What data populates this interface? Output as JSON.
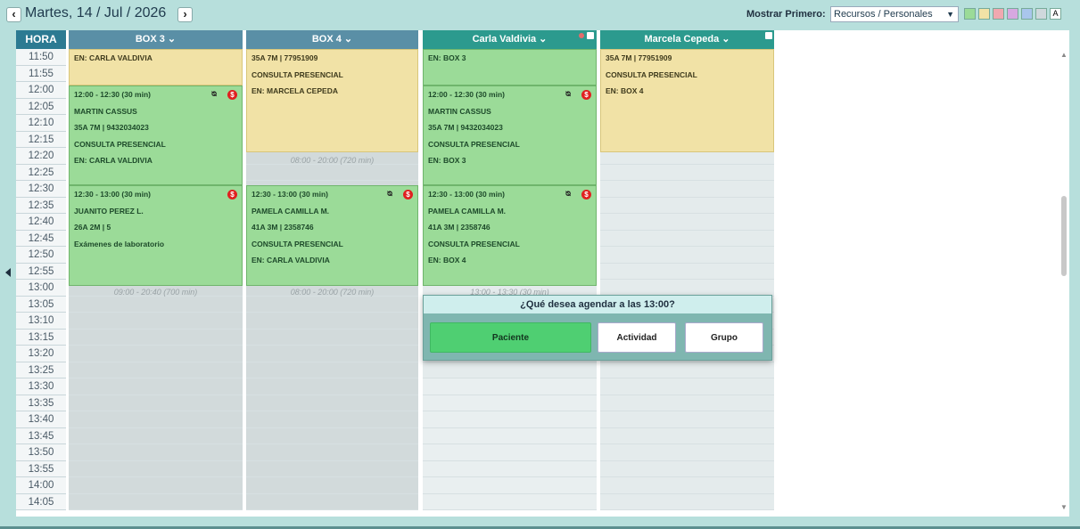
{
  "header": {
    "date_title": "Martes, 14 / Jul / 2026",
    "prev_icon": "chevron-left-icon",
    "next_icon": "chevron-right-icon",
    "show_first_label": "Mostrar Primero:",
    "show_first_value": "Recursos / Personales",
    "color_filters": [
      "#9bdb98",
      "#f1e2a6",
      "#f0a8b0",
      "#d7a8e0",
      "#a9c6ec",
      "#cfd8dc"
    ],
    "color_filter_text": "A"
  },
  "grid": {
    "hora_label": "HORA",
    "times": [
      "11:50",
      "11:55",
      "12:00",
      "12:05",
      "12:10",
      "12:15",
      "12:20",
      "12:25",
      "12:30",
      "12:35",
      "12:40",
      "12:45",
      "12:50",
      "12:55",
      "13:00",
      "13:05",
      "13:10",
      "13:15",
      "13:20",
      "13:25",
      "13:30",
      "13:35",
      "13:40",
      "13:45",
      "13:50",
      "13:55",
      "14:00",
      "14:05"
    ],
    "columns": [
      {
        "title": "BOX 3 ⌄",
        "color": "#5a8fa6"
      },
      {
        "title": "BOX 4 ⌄",
        "color": "#5a8fa6"
      },
      {
        "title": "Carla Valdivia ⌄",
        "color": "#2c9a8e"
      },
      {
        "title": "Marcela Cepeda ⌄",
        "color": "#2c9a8e"
      }
    ]
  },
  "appointments": {
    "box3_top": [
      "EN: CARLA VALDIVIA"
    ],
    "box3_a": [
      "12:00 - 12:30 (30 min)",
      "MARTIN CASSUS",
      "35A 7M | 9432034023",
      "CONSULTA PRESENCIAL",
      "EN: CARLA VALDIVIA"
    ],
    "box3_b": [
      "12:30 - 13:00 (30 min)",
      "JUANITO PEREZ L.",
      "26A 2M | 5",
      "Exámenes de laboratorio"
    ],
    "box3_avail": "09:00 - 20:40 (700 min)",
    "box4_top": [
      "35A 7M | 77951909",
      "CONSULTA PRESENCIAL",
      "EN: MARCELA CEPEDA"
    ],
    "box4_avail1": "08:00 - 20:00 (720 min)",
    "box4_b": [
      "12:30 - 13:00 (30 min)",
      "PAMELA CAMILLA M.",
      "41A 3M | 2358746",
      "CONSULTA PRESENCIAL",
      "EN: CARLA VALDIVIA"
    ],
    "box4_avail2": "08:00 - 20:00 (720 min)",
    "carla_top": [
      "EN: BOX 3"
    ],
    "carla_a": [
      "12:00 - 12:30 (30 min)",
      "MARTIN CASSUS",
      "35A 7M | 9432034023",
      "CONSULTA PRESENCIAL",
      "EN: BOX 3"
    ],
    "carla_b": [
      "12:30 - 13:00 (30 min)",
      "PAMELA CAMILLA M.",
      "41A 3M | 2358746",
      "CONSULTA PRESENCIAL",
      "EN: BOX 4"
    ],
    "carla_avail": "13:00 - 13:30 (30 min)",
    "marcela_top": [
      "35A 7M | 77951909",
      "CONSULTA PRESENCIAL",
      "EN: BOX 4"
    ],
    "payment_badge": "$"
  },
  "popup": {
    "title": "¿Qué desea agendar a las 13:00?",
    "btn_patient": "Paciente",
    "btn_activity": "Actividad",
    "btn_group": "Grupo"
  },
  "icons": {
    "link": "link-icon",
    "scroll_up": "▲",
    "scroll_down": "▼"
  }
}
